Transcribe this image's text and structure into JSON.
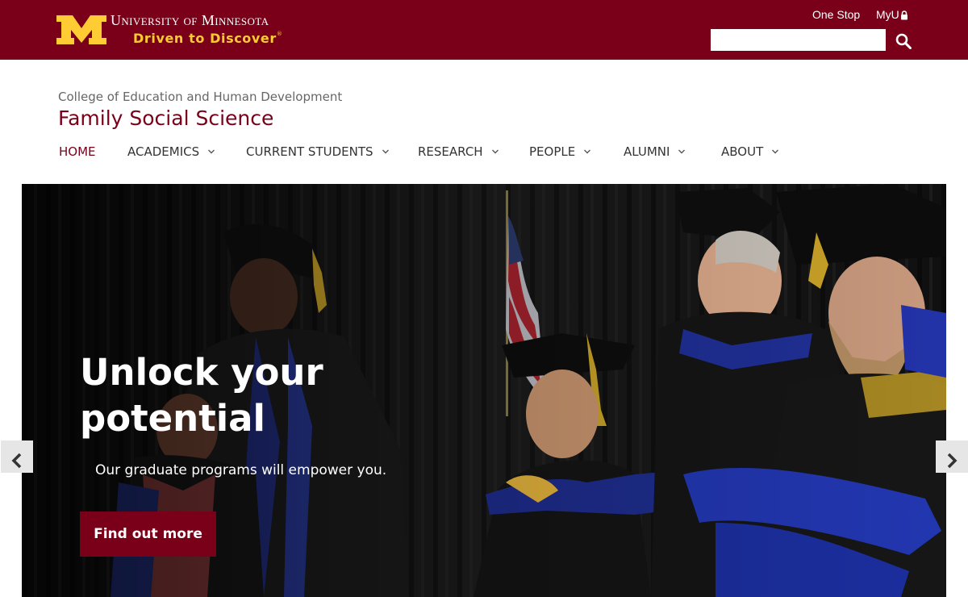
{
  "brand": {
    "university_name": "University of Minnesota",
    "tagline": "Driven to Discover",
    "tagline_mark": "®",
    "colors": {
      "maroon": "#7a0019",
      "gold": "#ffcc33"
    }
  },
  "utility_nav": {
    "one_stop_label": "One Stop",
    "myu_label": "MyU",
    "myu_icon": "lock-icon"
  },
  "search": {
    "placeholder": "",
    "value": "",
    "button_icon": "magnifier-icon"
  },
  "department": {
    "college": "College of Education and Human Development",
    "name": "Family Social Science"
  },
  "main_nav": {
    "items": [
      {
        "label": "HOME",
        "active": true,
        "has_dropdown": false
      },
      {
        "label": "ACADEMICS",
        "active": false,
        "has_dropdown": true
      },
      {
        "label": "CURRENT STUDENTS",
        "active": false,
        "has_dropdown": true
      },
      {
        "label": "RESEARCH",
        "active": false,
        "has_dropdown": true
      },
      {
        "label": "PEOPLE",
        "active": false,
        "has_dropdown": true
      },
      {
        "label": "ALUMNI",
        "active": false,
        "has_dropdown": true
      },
      {
        "label": "ABOUT",
        "active": false,
        "has_dropdown": true
      }
    ],
    "dropdown_icon": "chevron-down-icon"
  },
  "hero": {
    "title": "Unlock your potential",
    "subtitle": "Our graduate programs will empower you.",
    "cta_label": "Find out more",
    "image_subject": "doctoral-hooding-ceremony-photo",
    "prev_icon": "chevron-left-icon",
    "next_icon": "chevron-right-icon"
  }
}
